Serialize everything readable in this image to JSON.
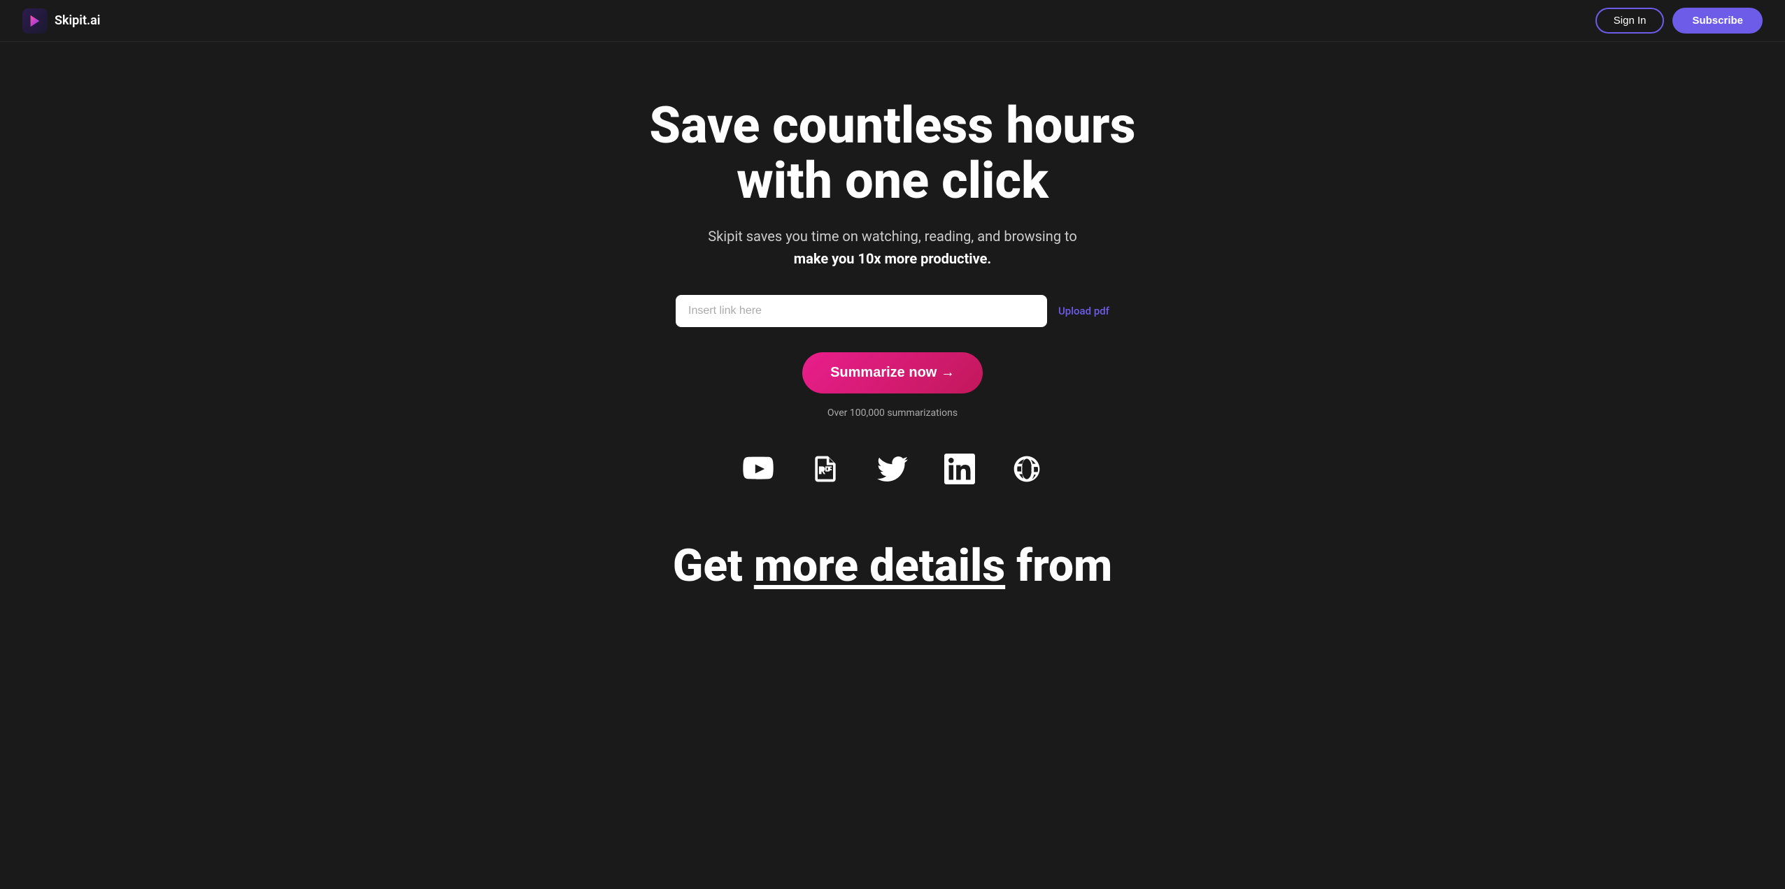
{
  "navbar": {
    "logo_text": "Skipit.ai",
    "signin_label": "Sign In",
    "subscribe_label": "Subscribe"
  },
  "hero": {
    "title_line1": "Save countless hours",
    "title_line2": "with one click",
    "subtitle_normal": "Skipit saves you time on watching, reading, and browsing to",
    "subtitle_bold": "make you 10x more productive.",
    "input_placeholder": "Insert link here",
    "upload_pdf_label": "Upload pdf",
    "summarize_button_label": "Summarize now →",
    "summarizations_count": "Over 100,000 summarizations"
  },
  "platforms": [
    {
      "name": "youtube",
      "label": "YouTube"
    },
    {
      "name": "pdf",
      "label": "PDF"
    },
    {
      "name": "twitter",
      "label": "Twitter"
    },
    {
      "name": "linkedin",
      "label": "LinkedIn"
    },
    {
      "name": "web",
      "label": "Web"
    }
  ],
  "bottom": {
    "line1": "Get",
    "line1_underline": "more details",
    "line1_end": "from"
  },
  "colors": {
    "accent_purple": "#6c5ce7",
    "accent_pink": "#e91e8c",
    "bg_dark": "#1a1a1a"
  }
}
